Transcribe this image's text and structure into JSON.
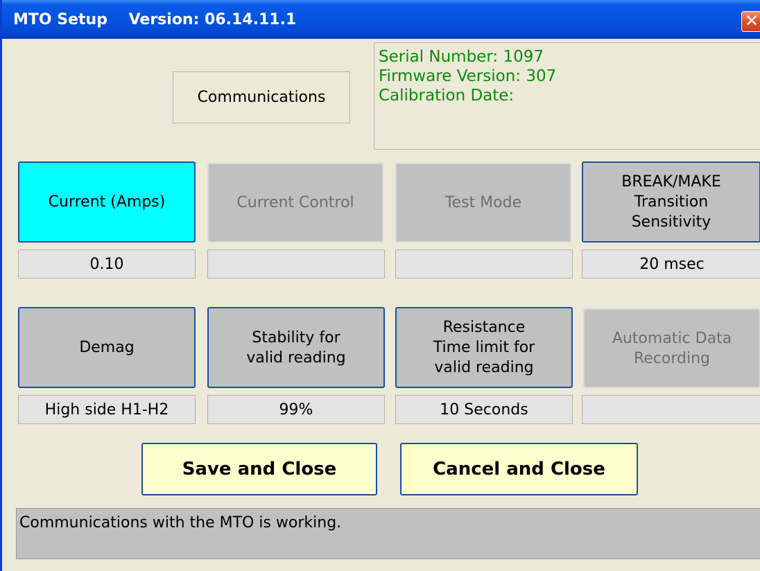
{
  "window": {
    "title": "MTO Setup    Version: 06.14.11.1",
    "close_glyph": "✕"
  },
  "communications_button": {
    "label": "Communications"
  },
  "device_info": {
    "serial_number": "Serial Number: 1097",
    "firmware_version": "Firmware Version: 307",
    "calibration_date": "Calibration Date:"
  },
  "settings_row1": [
    {
      "label": "Current (Amps)",
      "value": "0.10",
      "state": "selected"
    },
    {
      "label": "Current Control",
      "value": "",
      "state": "disabled"
    },
    {
      "label": "Test Mode",
      "value": "",
      "state": "disabled"
    },
    {
      "label_lines": [
        "BREAK/MAKE",
        "Transition",
        "Sensitivity"
      ],
      "value": "20 msec",
      "state": "enabled"
    }
  ],
  "settings_row2": [
    {
      "label": "Demag",
      "value": "High side H1-H2",
      "state": "enabled"
    },
    {
      "label_lines": [
        "Stability for",
        "valid reading"
      ],
      "value": "99%",
      "state": "enabled"
    },
    {
      "label_lines": [
        "Resistance",
        "Time limit for",
        "valid reading"
      ],
      "value": "10 Seconds",
      "state": "enabled"
    },
    {
      "label_lines": [
        "Automatic Data",
        "Recording"
      ],
      "value": "",
      "state": "disabled"
    }
  ],
  "actions": {
    "save_label": "Save and Close",
    "cancel_label": "Cancel and Close"
  },
  "status_bar": {
    "message": "Communications with the MTO is working."
  },
  "colors": {
    "title_bar": "#0454e0",
    "selected_tile": "#00ffff",
    "info_text": "#0a8c0a",
    "action_button": "#ffffcc"
  }
}
